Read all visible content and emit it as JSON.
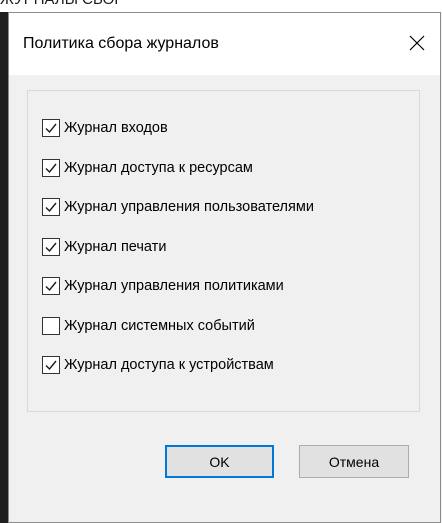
{
  "window": {
    "title": "Политика сбора журналов",
    "close_icon": "close-icon"
  },
  "backdrop": {
    "partial_text": "ЖУРНАЛЫ СБОР"
  },
  "checkboxes": [
    {
      "label": "Журнал входов",
      "checked": true
    },
    {
      "label": "Журнал доступа к ресурсам",
      "checked": true
    },
    {
      "label": "Журнал управления пользователями",
      "checked": true
    },
    {
      "label": "Журнал печати",
      "checked": true
    },
    {
      "label": "Журнал управления политиками",
      "checked": true
    },
    {
      "label": "Журнал системных событий",
      "checked": false
    },
    {
      "label": "Журнал доступа к устройствам",
      "checked": true
    }
  ],
  "buttons": {
    "ok_label": "OK",
    "cancel_label": "Отмена"
  },
  "colors": {
    "dialog_bg": "#f0f0f0",
    "titlebar_bg": "#ffffff",
    "default_button_border": "#0078d7",
    "button_bg": "#e1e1e1"
  }
}
